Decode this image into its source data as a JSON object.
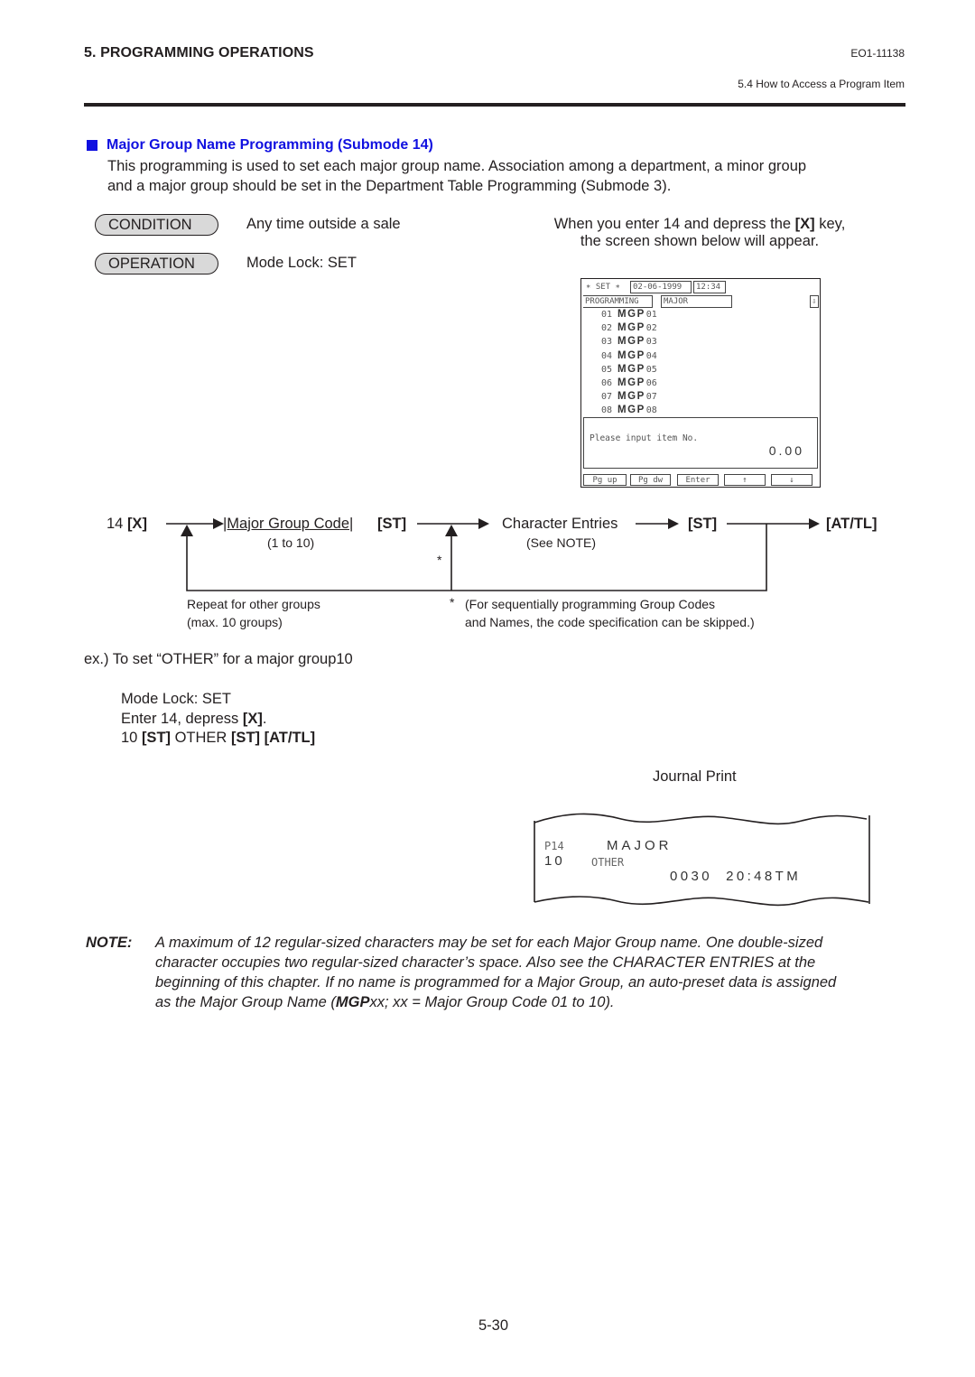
{
  "header": {
    "chapter_title": "5.  PROGRAMMING OPERATIONS",
    "doc_code": "EO1-11138",
    "section_ref": "5.4  How to Access a Program Item"
  },
  "section": {
    "title": "Major Group Name Programming (Submode 14)",
    "title_color": "#1010e0",
    "intro_line1": "This programming is used to set each major group name. Association among a department, a minor group",
    "intro_line2": "and a major group should be set in the Department Table Programming (Submode 3)."
  },
  "condition": {
    "label": "CONDITION",
    "value": "Any time outside a sale"
  },
  "operation": {
    "label": "OPERATION",
    "value": "Mode Lock:  SET"
  },
  "screen_caption": {
    "line1_pre": "When you enter 14 and depress the ",
    "line1_key": "[X]",
    "line1_post": " key,",
    "line2": "the screen shown below will appear."
  },
  "screen": {
    "mode": "∗ SET ∗",
    "date": "02-06-1999",
    "time": "12:34",
    "mode_label": "PROGRAMMING",
    "submode_label": "MAJOR",
    "scroll_icon": "⇩",
    "rows": [
      {
        "code": "01",
        "name": "MGP",
        "suffix": "01"
      },
      {
        "code": "02",
        "name": "MGP",
        "suffix": "02"
      },
      {
        "code": "03",
        "name": "MGP",
        "suffix": "03"
      },
      {
        "code": "04",
        "name": "MGP",
        "suffix": "04"
      },
      {
        "code": "05",
        "name": "MGP",
        "suffix": "05"
      },
      {
        "code": "06",
        "name": "MGP",
        "suffix": "06"
      },
      {
        "code": "07",
        "name": "MGP",
        "suffix": "07"
      },
      {
        "code": "08",
        "name": "MGP",
        "suffix": "08"
      }
    ],
    "prompt": "Please input item No.",
    "amount": "0.00",
    "buttons": [
      "Pg up",
      "Pg dw",
      "Enter",
      "↑",
      "↓"
    ]
  },
  "flow": {
    "start": "14 ",
    "start_key": "[X]",
    "code_label": "|Major Group Code|",
    "code_range": "(1 to 10)",
    "st1": "[ST]",
    "chars_label": "Character Entries",
    "chars_note": "(See NOTE)",
    "st2": "[ST]",
    "end_key": "[AT/TL]",
    "asterisk": "*",
    "repeat_line1": "Repeat for other groups",
    "repeat_line2": "(max. 10 groups)",
    "footnote_mark": "*",
    "footnote_line1": "(For sequentially programming Group Codes",
    "footnote_line2": "and Names, the code specification can be skipped.)"
  },
  "example": {
    "title": "ex.)  To set “OTHER” for a major group10",
    "line1": "Mode Lock:  SET",
    "line2_pre": "Enter 14, depress ",
    "line2_key": "[X]",
    "line2_post": ".",
    "line3_a": "10 ",
    "line3_b": "[ST]",
    "line3_c": "  OTHER ",
    "line3_d": "[ST]",
    "line3_e": "  [AT/TL]"
  },
  "journal": {
    "caption": "Journal Print",
    "line1_code": "P14",
    "line1_title": "MAJOR",
    "line2_num": "10",
    "line2_name": "OTHER",
    "line3": "0030  20:48TM"
  },
  "note": {
    "label": "NOTE:",
    "line1": "A maximum of 12 regular-sized characters may be set for each Major Group name. One double-sized",
    "line2": "character occupies two regular-sized character’s space. Also see the CHARACTER ENTRIES at the",
    "line3": "beginning of this chapter. If no name is programmed for a Major Group, an auto-preset data is assigned",
    "line4_pre": "as the Major Group Name (",
    "line4_bold": "MGP",
    "line4_post": "xx;  xx = Major Group Code 01 to 10)."
  },
  "page_number": "5-30"
}
